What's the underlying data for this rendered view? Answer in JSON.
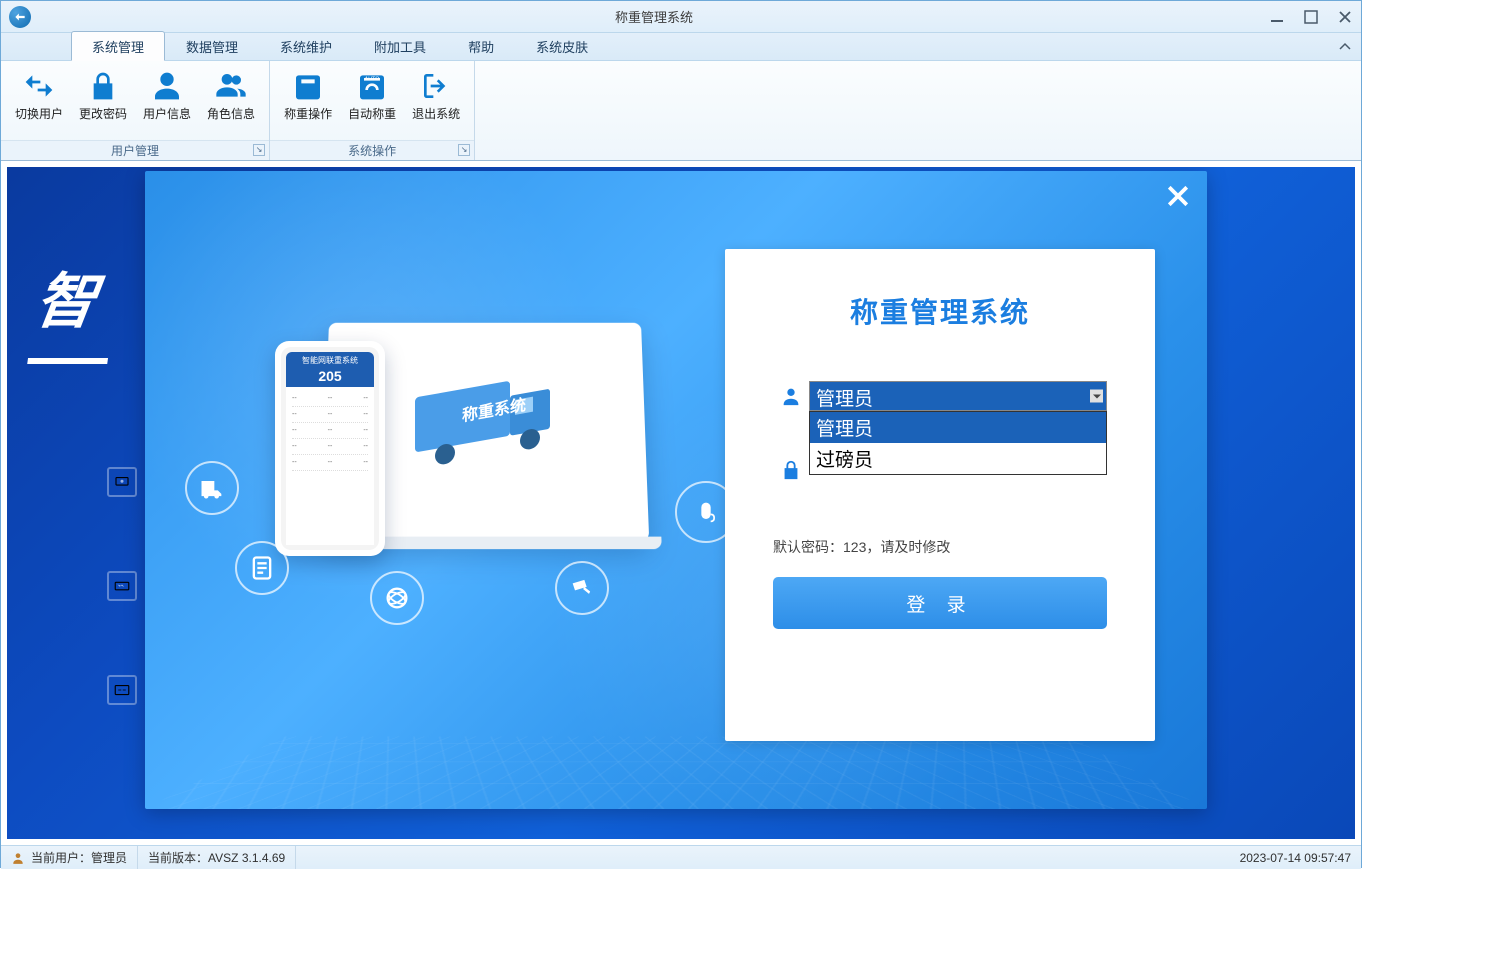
{
  "window": {
    "title": "称重管理系统"
  },
  "tabs": [
    {
      "label": "系统管理",
      "active": true
    },
    {
      "label": "数据管理",
      "active": false
    },
    {
      "label": "系统维护",
      "active": false
    },
    {
      "label": "附加工具",
      "active": false
    },
    {
      "label": "帮助",
      "active": false
    },
    {
      "label": "系统皮肤",
      "active": false
    }
  ],
  "ribbon": {
    "groups": [
      {
        "label": "用户管理",
        "buttons": [
          {
            "label": "切换用户",
            "icon": "switch-user"
          },
          {
            "label": "更改密码",
            "icon": "lock"
          },
          {
            "label": "用户信息",
            "icon": "user"
          },
          {
            "label": "角色信息",
            "icon": "role"
          }
        ]
      },
      {
        "label": "系统操作",
        "buttons": [
          {
            "label": "称重操作",
            "icon": "weigh"
          },
          {
            "label": "自动称重",
            "icon": "auto-weigh"
          },
          {
            "label": "退出系统",
            "icon": "exit"
          }
        ]
      }
    ]
  },
  "background": {
    "heading": "智"
  },
  "login": {
    "title": "称重管理系统",
    "username_value": "管理员",
    "dropdown_options": [
      {
        "label": "管理员",
        "selected": true
      },
      {
        "label": "过磅员",
        "selected": false
      }
    ],
    "password_value": "",
    "hint": "默认密码：123，请及时修改",
    "button_label": "登 录"
  },
  "statusbar": {
    "user_label": "当前用户：",
    "user_value": "管理员",
    "version_label": "当前版本：",
    "version_value": "AVSZ 3.1.4.69",
    "datetime": "2023-07-14 09:57:47"
  },
  "illustration": {
    "truck_text": "称重系统",
    "phone_title": "智能网联重系统",
    "phone_number": "205"
  }
}
